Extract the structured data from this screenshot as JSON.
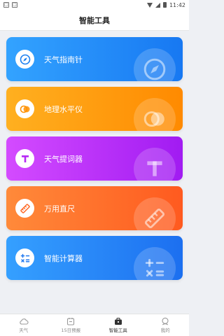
{
  "status": {
    "time": "11:42"
  },
  "header": {
    "title": "智能工具"
  },
  "tools": [
    {
      "label": "天气指南针",
      "icon": "compass-icon",
      "gradient": [
        "#33a3ff",
        "#1778f2"
      ],
      "icon_color": "#1a7ff0"
    },
    {
      "label": "地理水平仪",
      "icon": "level-icon",
      "gradient": [
        "#ffb020",
        "#ff8a00"
      ],
      "icon_color": "#ff9000"
    },
    {
      "label": "天气提词器",
      "icon": "teleprompter-icon",
      "gradient": [
        "#d44bff",
        "#a11bf2"
      ],
      "icon_color": "#b629f5"
    },
    {
      "label": "万用直尺",
      "icon": "ruler-icon",
      "gradient": [
        "#ff8a3a",
        "#ff5a1f"
      ],
      "icon_color": "#ff6a26"
    },
    {
      "label": "智能计算器",
      "icon": "calculator-icon",
      "gradient": [
        "#35a0ff",
        "#1c6ff0"
      ],
      "icon_color": "#1f78f0"
    }
  ],
  "tabs": [
    {
      "label": "天气",
      "icon": "cloud-icon",
      "active": false
    },
    {
      "label": "15日预报",
      "icon": "calendar-icon",
      "active": false
    },
    {
      "label": "智能工具",
      "icon": "toolbox-icon",
      "active": true
    },
    {
      "label": "我的",
      "icon": "profile-icon",
      "active": false
    }
  ]
}
